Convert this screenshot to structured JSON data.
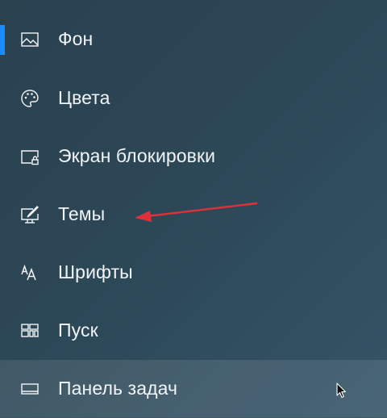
{
  "accent_color": "#1a8cff",
  "annotation_arrow_color": "#e0303a",
  "nav": {
    "items": [
      {
        "label": "Фон",
        "icon": "picture-icon",
        "active": true
      },
      {
        "label": "Цвета",
        "icon": "palette-icon",
        "active": false
      },
      {
        "label": "Экран блокировки",
        "icon": "lock-screen-icon",
        "active": false
      },
      {
        "label": "Темы",
        "icon": "themes-icon",
        "active": false
      },
      {
        "label": "Шрифты",
        "icon": "fonts-icon",
        "active": false
      },
      {
        "label": "Пуск",
        "icon": "start-icon",
        "active": false
      },
      {
        "label": "Панель задач",
        "icon": "taskbar-icon",
        "active": false,
        "hovered": true
      }
    ]
  }
}
